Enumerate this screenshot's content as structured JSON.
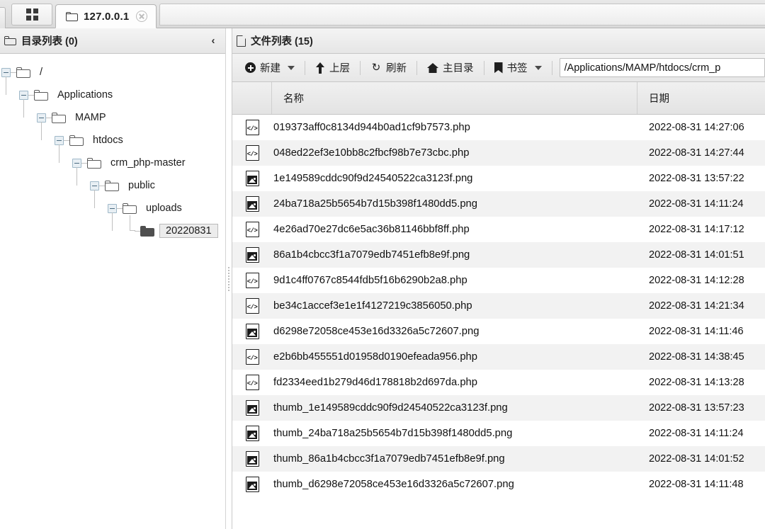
{
  "tabbar": {
    "grid_button": "grid-view",
    "active_tab": {
      "title": "127.0.0.1",
      "icon": "folder-icon",
      "close": "close-icon"
    }
  },
  "sidebar": {
    "header": {
      "icon": "folder-icon",
      "title": "目录列表 (0)",
      "collapse": "‹"
    },
    "tree": [
      {
        "label": "/",
        "depth": 0,
        "selected": false
      },
      {
        "label": "Applications",
        "depth": 1,
        "selected": false
      },
      {
        "label": "MAMP",
        "depth": 2,
        "selected": false
      },
      {
        "label": "htdocs",
        "depth": 3,
        "selected": false
      },
      {
        "label": "crm_php-master",
        "depth": 4,
        "selected": false
      },
      {
        "label": "public",
        "depth": 5,
        "selected": false
      },
      {
        "label": "uploads",
        "depth": 6,
        "selected": false
      },
      {
        "label": "20220831",
        "depth": 7,
        "selected": true
      }
    ]
  },
  "main": {
    "header": {
      "icon": "file-icon",
      "title": "文件列表 (15)"
    },
    "toolbar": {
      "new_label": "新建",
      "up_label": "上层",
      "refresh_label": "刷新",
      "home_label": "主目录",
      "bookmark_label": "书签",
      "path_value": "/Applications/MAMP/htdocs/crm_p"
    },
    "columns": {
      "icon": "",
      "name": "名称",
      "date": "日期"
    },
    "rows": [
      {
        "icon": "php-file-icon",
        "name": "019373aff0c8134d944b0ad1cf9b7573.php",
        "date": "2022-08-31 14:27:06"
      },
      {
        "icon": "php-file-icon",
        "name": "048ed22ef3e10bb8c2fbcf98b7e73cbc.php",
        "date": "2022-08-31 14:27:44"
      },
      {
        "icon": "image-file-icon",
        "name": "1e149589cddc90f9d24540522ca3123f.png",
        "date": "2022-08-31 13:57:22"
      },
      {
        "icon": "image-file-icon",
        "name": "24ba718a25b5654b7d15b398f1480dd5.png",
        "date": "2022-08-31 14:11:24"
      },
      {
        "icon": "php-file-icon",
        "name": "4e26ad70e27dc6e5ac36b81146bbf8ff.php",
        "date": "2022-08-31 14:17:12"
      },
      {
        "icon": "image-file-icon",
        "name": "86a1b4cbcc3f1a7079edb7451efb8e9f.png",
        "date": "2022-08-31 14:01:51"
      },
      {
        "icon": "php-file-icon",
        "name": "9d1c4ff0767c8544fdb5f16b6290b2a8.php",
        "date": "2022-08-31 14:12:28"
      },
      {
        "icon": "php-file-icon",
        "name": "be34c1accef3e1e1f4127219c3856050.php",
        "date": "2022-08-31 14:21:34"
      },
      {
        "icon": "image-file-icon",
        "name": "d6298e72058ce453e16d3326a5c72607.png",
        "date": "2022-08-31 14:11:46"
      },
      {
        "icon": "php-file-icon",
        "name": "e2b6bb455551d01958d0190efeada956.php",
        "date": "2022-08-31 14:38:45"
      },
      {
        "icon": "php-file-icon",
        "name": "fd2334eed1b279d46d178818b2d697da.php",
        "date": "2022-08-31 14:13:28"
      },
      {
        "icon": "image-file-icon",
        "name": "thumb_1e149589cddc90f9d24540522ca3123f.png",
        "date": "2022-08-31 13:57:23"
      },
      {
        "icon": "image-file-icon",
        "name": "thumb_24ba718a25b5654b7d15b398f1480dd5.png",
        "date": "2022-08-31 14:11:24"
      },
      {
        "icon": "image-file-icon",
        "name": "thumb_86a1b4cbcc3f1a7079edb7451efb8e9f.png",
        "date": "2022-08-31 14:01:52"
      },
      {
        "icon": "image-file-icon",
        "name": "thumb_d6298e72058ce453e16d3326a5c72607.png",
        "date": "2022-08-31 14:11:48"
      }
    ]
  },
  "colors": {
    "accent": "#4b6b80",
    "row_alt": "#f2f2f2",
    "chrome": "#e7e7e7",
    "text": "#111111"
  }
}
